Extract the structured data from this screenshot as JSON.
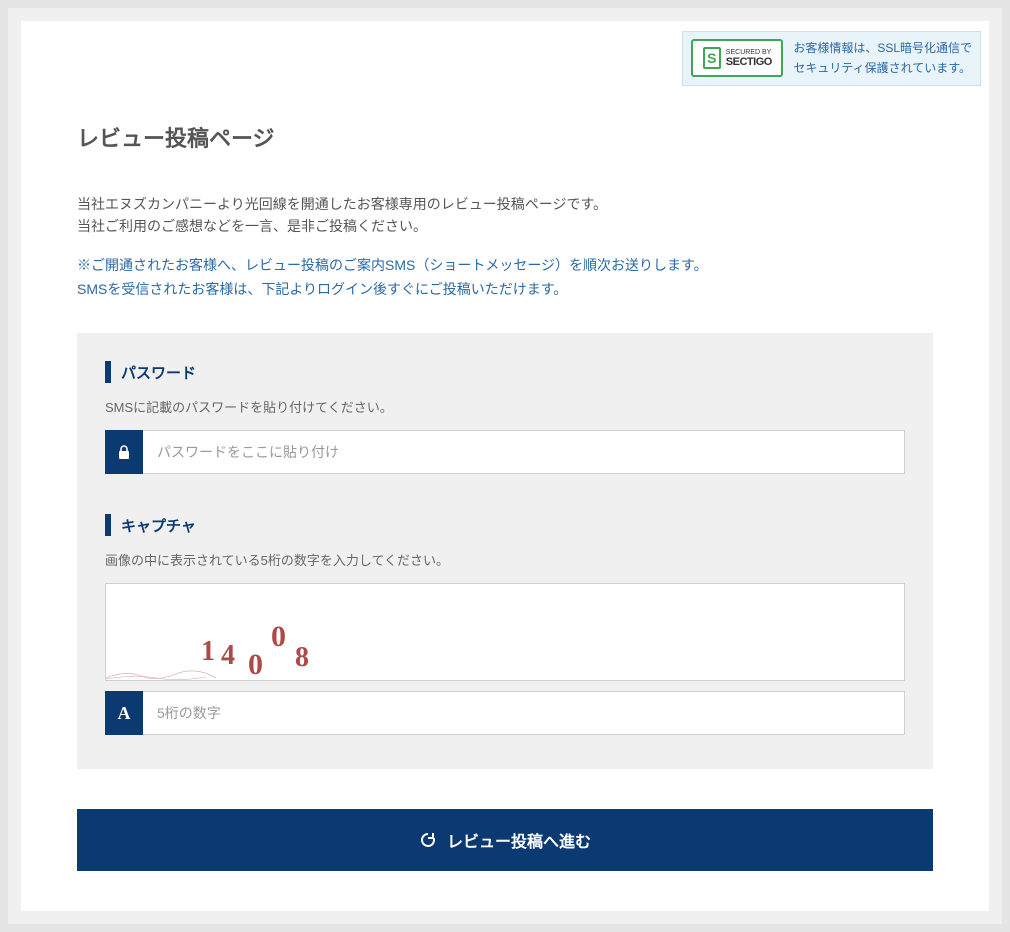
{
  "ssl_badge": {
    "secured_by": "SECURED BY",
    "brand": "SECTIGO",
    "description_line1": "お客様情報は、SSL暗号化通信で",
    "description_line2": "セキュリティ保護されています。"
  },
  "page": {
    "title": "レビュー投稿ページ",
    "intro_line1": "当社エヌズカンパニーより光回線を開通したお客様専用のレビュー投稿ページです。",
    "intro_line2": "当社ご利用のご感想などを一言、是非ご投稿ください。",
    "notice_line1": "※ご開通されたお客様へ、レビュー投稿のご案内SMS（ショートメッセージ）を順次お送りします。",
    "notice_line2": "SMSを受信されたお客様は、下記よりログイン後すぐにご投稿いただけます。"
  },
  "form": {
    "password": {
      "label": "パスワード",
      "help": "SMSに記載のパスワードを貼り付けてください。",
      "placeholder": "パスワードをここに貼り付け",
      "value": ""
    },
    "captcha": {
      "label": "キャプチャ",
      "help": "画像の中に表示されている5桁の数字を入力してください。",
      "image_digits": [
        "1",
        "4",
        "0",
        "0",
        "8"
      ],
      "placeholder": "5桁の数字",
      "value": "",
      "icon_char": "A"
    }
  },
  "submit": {
    "label": "レビュー投稿へ進む"
  }
}
